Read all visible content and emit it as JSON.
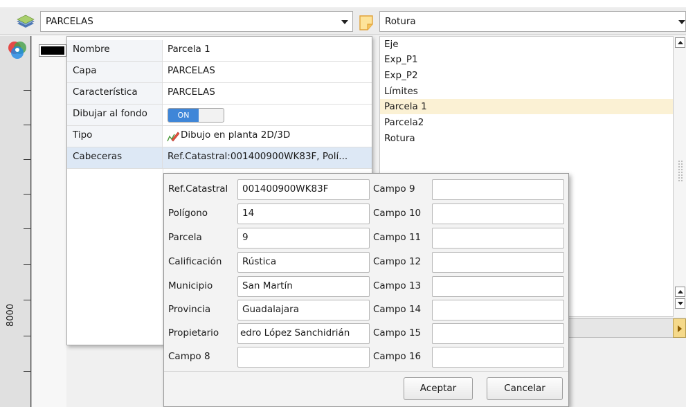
{
  "toolbar": {
    "layer_select": "PARCELAS",
    "feature_select": "Rotura"
  },
  "ruler": {
    "label": "8000"
  },
  "list": {
    "items": [
      "Eje",
      "Exp_P1",
      "Exp_P2",
      "Límites",
      "Parcela 1",
      "Parcela2",
      "Rotura"
    ],
    "selected": "Parcela 1"
  },
  "props": {
    "rows": [
      {
        "key": "Nombre",
        "value": "Parcela 1"
      },
      {
        "key": "Capa",
        "value": "PARCELAS"
      },
      {
        "key": "Característica",
        "value": "PARCELAS"
      },
      {
        "key": "Dibujar al fondo",
        "value": "ON"
      },
      {
        "key": "Tipo",
        "value": "Dibujo en planta 2D/3D"
      },
      {
        "key": "Cabeceras",
        "value": "Ref.Catastral:001400900WK83F, Polí..."
      }
    ]
  },
  "dialog": {
    "left_fields": [
      {
        "label": "Ref.Catastral",
        "value": "001400900WK83F"
      },
      {
        "label": "Polígono",
        "value": "14"
      },
      {
        "label": "Parcela",
        "value": "9"
      },
      {
        "label": "Calificación",
        "value": "Rústica"
      },
      {
        "label": "Municipio",
        "value": "San Martín"
      },
      {
        "label": "Provincia",
        "value": "Guadalajara"
      },
      {
        "label": "Propietario",
        "value": "edro López Sanchidrián"
      },
      {
        "label": "Campo 8",
        "value": ""
      }
    ],
    "right_fields": [
      {
        "label": "Campo 9",
        "value": ""
      },
      {
        "label": "Campo 10",
        "value": ""
      },
      {
        "label": "Campo 11",
        "value": ""
      },
      {
        "label": "Campo 12",
        "value": ""
      },
      {
        "label": "Campo 13",
        "value": ""
      },
      {
        "label": "Campo 14",
        "value": ""
      },
      {
        "label": "Campo 15",
        "value": ""
      },
      {
        "label": "Campo 16",
        "value": ""
      }
    ],
    "accept": "Aceptar",
    "cancel": "Cancelar"
  },
  "colors": {
    "accent": "#3f86d8",
    "selection": "#fbf1d4",
    "color_swatch": "#000000"
  }
}
